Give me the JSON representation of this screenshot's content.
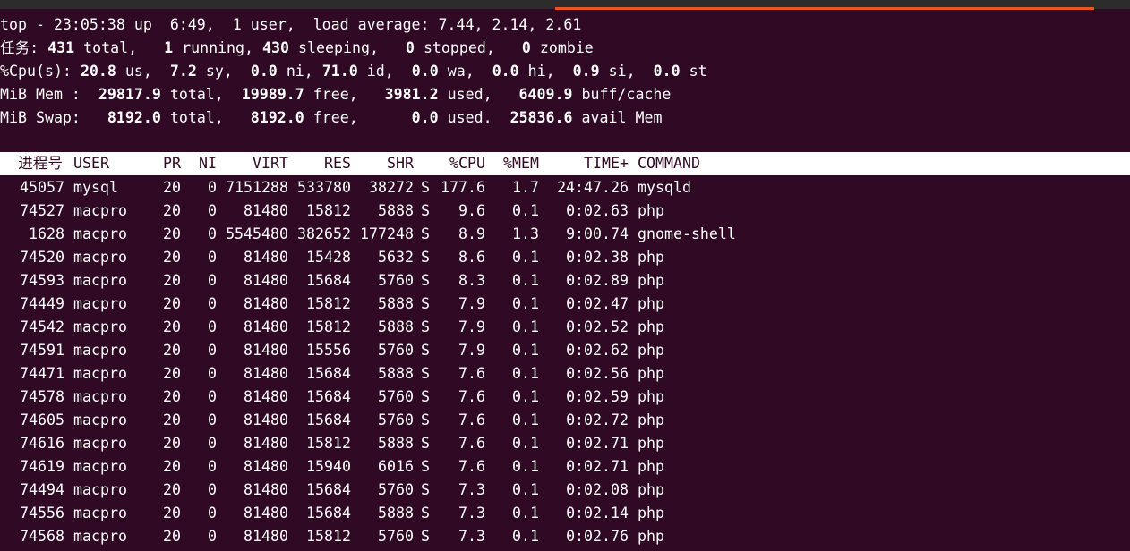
{
  "summary": {
    "line1": "top - 23:05:38 up  6:49,  1 user,  load average: 7.44, 2.14, 2.61",
    "tasks": {
      "label": "任务:",
      "total": "431",
      "total_label": "total,",
      "running": "1",
      "running_label": "running,",
      "sleeping": "430",
      "sleeping_label": "sleeping,",
      "stopped": "0",
      "stopped_label": "stopped,",
      "zombie": "0",
      "zombie_label": "zombie"
    },
    "cpu": {
      "label": "%Cpu(s):",
      "us": "20.8",
      "us_label": "us,",
      "sy": "7.2",
      "sy_label": "sy,",
      "ni": "0.0",
      "ni_label": "ni,",
      "id": "71.0",
      "id_label": "id,",
      "wa": "0.0",
      "wa_label": "wa,",
      "hi": "0.0",
      "hi_label": "hi,",
      "si": "0.9",
      "si_label": "si,",
      "st": "0.0",
      "st_label": "st"
    },
    "mem": {
      "label": "MiB Mem :",
      "total": "29817.9",
      "total_label": "total,",
      "free": "19989.7",
      "free_label": "free,",
      "used": "3981.2",
      "used_label": "used,",
      "buff": "6409.9",
      "buff_label": "buff/cache"
    },
    "swap": {
      "label": "MiB Swap:",
      "total": "8192.0",
      "total_label": "total,",
      "free": "8192.0",
      "free_label": "free,",
      "used": "0.0",
      "used_label": "used.",
      "avail": "25836.6",
      "avail_label": "avail Mem"
    }
  },
  "columns": {
    "pid": "进程号",
    "user": "USER",
    "pr": "PR",
    "ni": "NI",
    "virt": "VIRT",
    "res": "RES",
    "shr": "SHR",
    "s": "",
    "cpu": "%CPU",
    "mem": "%MEM",
    "time": "TIME+",
    "cmd": "COMMAND"
  },
  "processes": [
    {
      "pid": "45057",
      "user": "mysql",
      "pr": "20",
      "ni": "0",
      "virt": "7151288",
      "res": "533780",
      "shr": "38272",
      "s": "S",
      "cpu": "177.6",
      "mem": "1.7",
      "time": "24:47.26",
      "cmd": "mysqld"
    },
    {
      "pid": "74527",
      "user": "macpro",
      "pr": "20",
      "ni": "0",
      "virt": "81480",
      "res": "15812",
      "shr": "5888",
      "s": "S",
      "cpu": "9.6",
      "mem": "0.1",
      "time": "0:02.63",
      "cmd": "php"
    },
    {
      "pid": "1628",
      "user": "macpro",
      "pr": "20",
      "ni": "0",
      "virt": "5545480",
      "res": "382652",
      "shr": "177248",
      "s": "S",
      "cpu": "8.9",
      "mem": "1.3",
      "time": "9:00.74",
      "cmd": "gnome-shell"
    },
    {
      "pid": "74520",
      "user": "macpro",
      "pr": "20",
      "ni": "0",
      "virt": "81480",
      "res": "15428",
      "shr": "5632",
      "s": "S",
      "cpu": "8.6",
      "mem": "0.1",
      "time": "0:02.38",
      "cmd": "php"
    },
    {
      "pid": "74593",
      "user": "macpro",
      "pr": "20",
      "ni": "0",
      "virt": "81480",
      "res": "15684",
      "shr": "5760",
      "s": "S",
      "cpu": "8.3",
      "mem": "0.1",
      "time": "0:02.89",
      "cmd": "php"
    },
    {
      "pid": "74449",
      "user": "macpro",
      "pr": "20",
      "ni": "0",
      "virt": "81480",
      "res": "15812",
      "shr": "5888",
      "s": "S",
      "cpu": "7.9",
      "mem": "0.1",
      "time": "0:02.47",
      "cmd": "php"
    },
    {
      "pid": "74542",
      "user": "macpro",
      "pr": "20",
      "ni": "0",
      "virt": "81480",
      "res": "15812",
      "shr": "5888",
      "s": "S",
      "cpu": "7.9",
      "mem": "0.1",
      "time": "0:02.52",
      "cmd": "php"
    },
    {
      "pid": "74591",
      "user": "macpro",
      "pr": "20",
      "ni": "0",
      "virt": "81480",
      "res": "15556",
      "shr": "5760",
      "s": "S",
      "cpu": "7.9",
      "mem": "0.1",
      "time": "0:02.62",
      "cmd": "php"
    },
    {
      "pid": "74471",
      "user": "macpro",
      "pr": "20",
      "ni": "0",
      "virt": "81480",
      "res": "15684",
      "shr": "5888",
      "s": "S",
      "cpu": "7.6",
      "mem": "0.1",
      "time": "0:02.56",
      "cmd": "php"
    },
    {
      "pid": "74578",
      "user": "macpro",
      "pr": "20",
      "ni": "0",
      "virt": "81480",
      "res": "15684",
      "shr": "5760",
      "s": "S",
      "cpu": "7.6",
      "mem": "0.1",
      "time": "0:02.59",
      "cmd": "php"
    },
    {
      "pid": "74605",
      "user": "macpro",
      "pr": "20",
      "ni": "0",
      "virt": "81480",
      "res": "15684",
      "shr": "5760",
      "s": "S",
      "cpu": "7.6",
      "mem": "0.1",
      "time": "0:02.72",
      "cmd": "php"
    },
    {
      "pid": "74616",
      "user": "macpro",
      "pr": "20",
      "ni": "0",
      "virt": "81480",
      "res": "15812",
      "shr": "5888",
      "s": "S",
      "cpu": "7.6",
      "mem": "0.1",
      "time": "0:02.71",
      "cmd": "php"
    },
    {
      "pid": "74619",
      "user": "macpro",
      "pr": "20",
      "ni": "0",
      "virt": "81480",
      "res": "15940",
      "shr": "6016",
      "s": "S",
      "cpu": "7.6",
      "mem": "0.1",
      "time": "0:02.71",
      "cmd": "php"
    },
    {
      "pid": "74494",
      "user": "macpro",
      "pr": "20",
      "ni": "0",
      "virt": "81480",
      "res": "15684",
      "shr": "5760",
      "s": "S",
      "cpu": "7.3",
      "mem": "0.1",
      "time": "0:02.08",
      "cmd": "php"
    },
    {
      "pid": "74556",
      "user": "macpro",
      "pr": "20",
      "ni": "0",
      "virt": "81480",
      "res": "15684",
      "shr": "5888",
      "s": "S",
      "cpu": "7.3",
      "mem": "0.1",
      "time": "0:02.14",
      "cmd": "php"
    },
    {
      "pid": "74568",
      "user": "macpro",
      "pr": "20",
      "ni": "0",
      "virt": "81480",
      "res": "15812",
      "shr": "5760",
      "s": "S",
      "cpu": "7.3",
      "mem": "0.1",
      "time": "0:02.76",
      "cmd": "php"
    }
  ],
  "colors": {
    "background": "#300a24",
    "foreground": "#ffffff",
    "header_bg": "#ffffff",
    "tab_accent": "#e95420"
  }
}
